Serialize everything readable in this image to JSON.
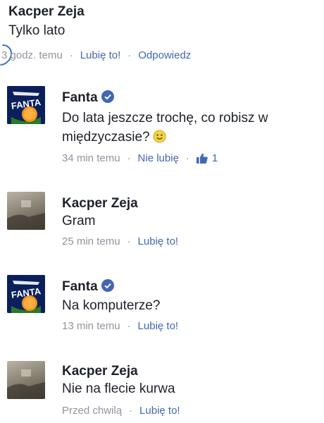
{
  "comments": [
    {
      "author": "Kacper Zeja",
      "text": "Tylko lato",
      "time": "3 godz. temu",
      "actions": [
        "Lubię to!",
        "Odpowiedz"
      ]
    },
    {
      "author": "Fanta",
      "verified": true,
      "text": "Do lata jeszcze trochę, co robisz w międzyczasie?",
      "time": "34 min temu",
      "actions": [
        "Nie lubię"
      ],
      "like_count": "1"
    },
    {
      "author": "Kacper Zeja",
      "text": "Gram",
      "time": "25 min temu",
      "actions": [
        "Lubię to!"
      ]
    },
    {
      "author": "Fanta",
      "verified": true,
      "text": "Na komputerze?",
      "time": "13 min temu",
      "actions": [
        "Lubię to!"
      ]
    },
    {
      "author": "Kacper Zeja",
      "text": "Nie na flecie kurwa",
      "time": "Przed chwilą",
      "actions": [
        "Lubię to!"
      ]
    }
  ],
  "fanta_logo_text": "FANTA",
  "colors": {
    "action": "#4267b2",
    "meta": "#90949c",
    "verified": "#4267b2",
    "fanta_bg": "#0a1f5c",
    "fanta_orange": "#f7941d"
  },
  "icons": {
    "separator": "·",
    "like": "thumbs-up-icon",
    "verified": "verified-badge-icon",
    "emoji": "smiley-emoji-icon"
  }
}
